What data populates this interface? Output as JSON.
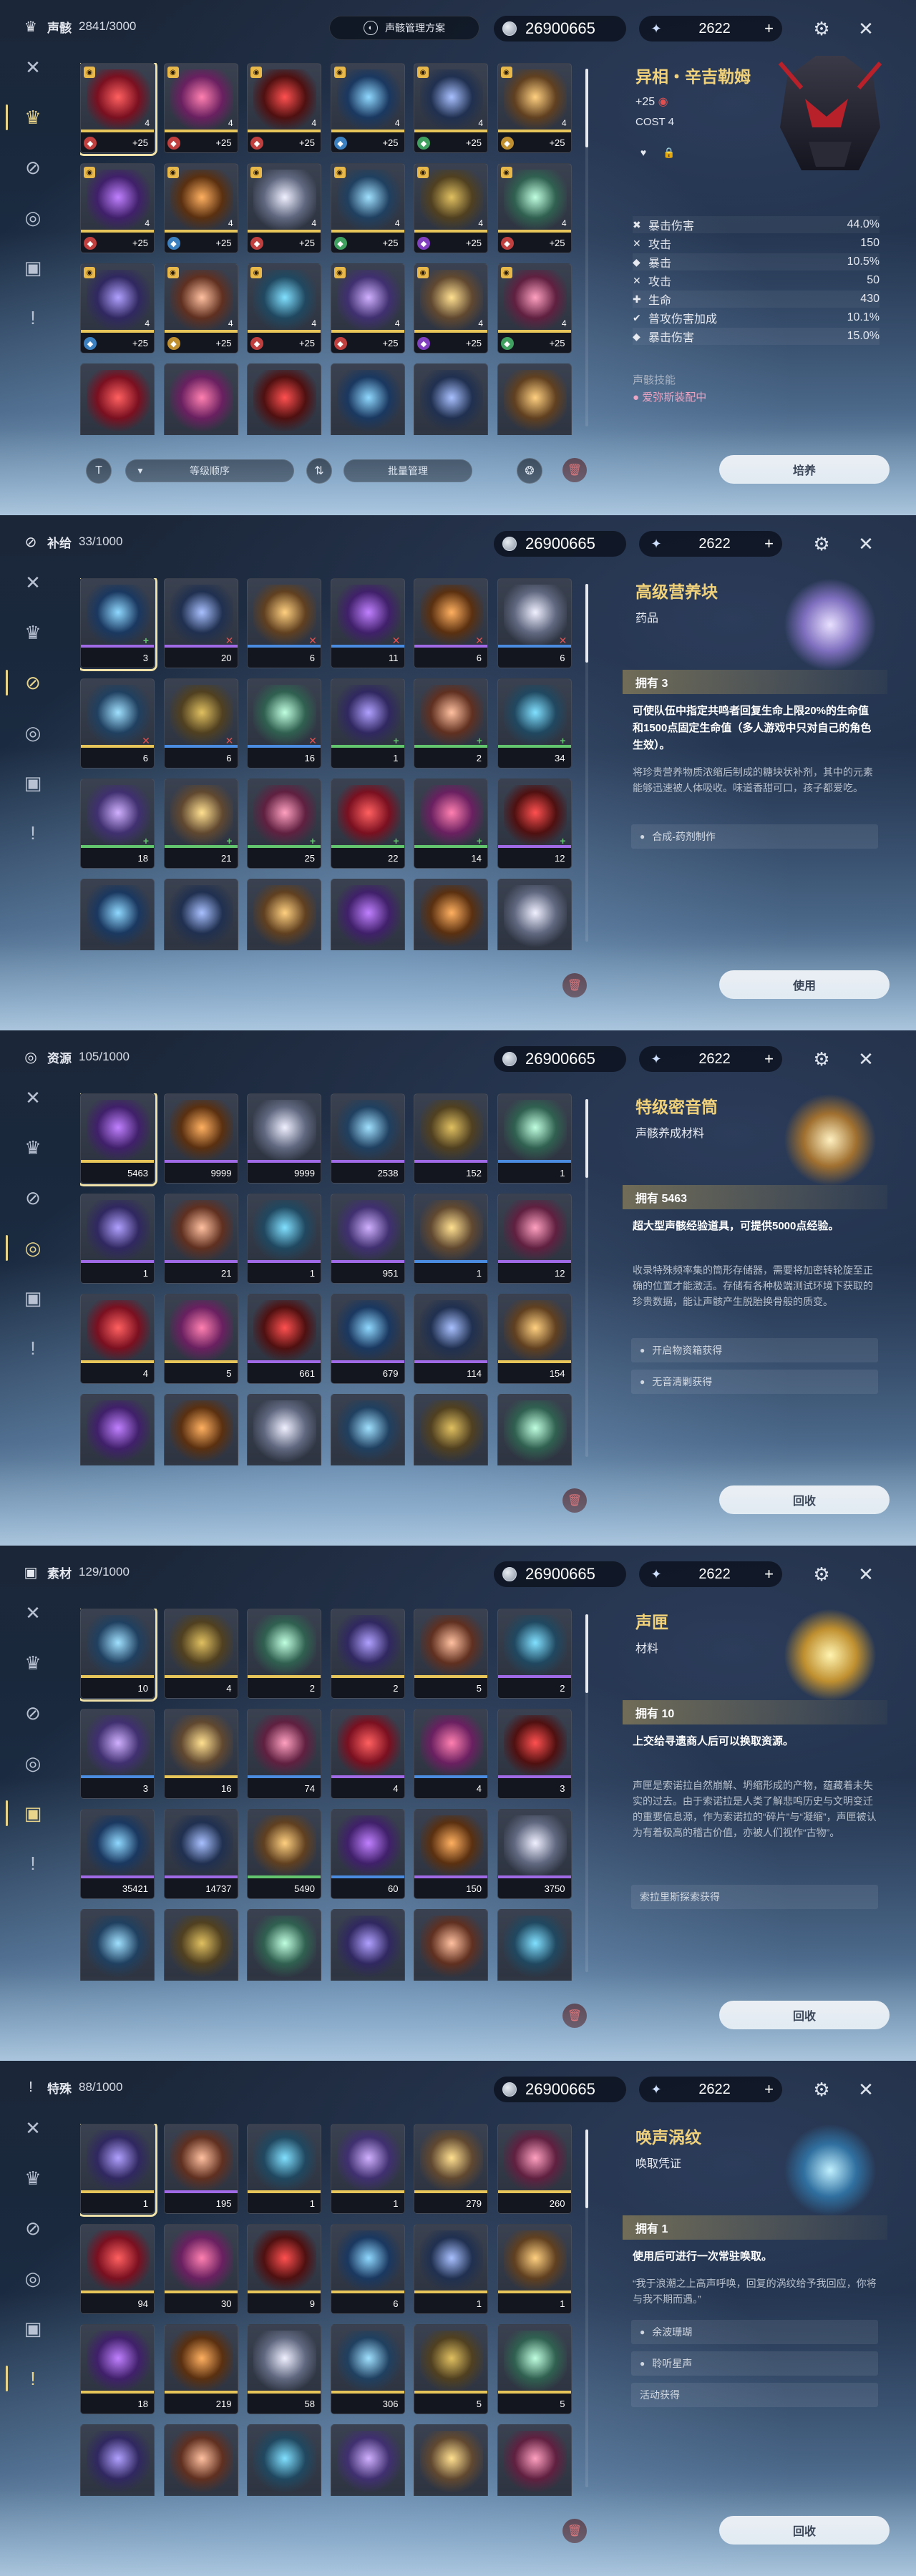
{
  "common": {
    "currency1": "26900665",
    "currency2": "2622",
    "plus": "+",
    "echo_plan_label": "声骸管理方案"
  },
  "panels": [
    {
      "category": "声骸",
      "count": "2841/3000",
      "title": "异相・辛吉勒姆",
      "plus_level": "+25",
      "cost": "COST 4",
      "stats": [
        {
          "name": "暴击伤害",
          "value": "44.0%"
        },
        {
          "name": "攻击",
          "value": "150"
        },
        {
          "name": "暴击",
          "value": "10.5%"
        },
        {
          "name": "攻击",
          "value": "50"
        },
        {
          "name": "生命",
          "value": "430"
        },
        {
          "name": "普攻伤害加成",
          "value": "10.1%"
        },
        {
          "name": "暴击伤害",
          "value": "15.0%"
        }
      ],
      "skill_header": "声骸技能",
      "equipped_by": "爱弥斯装配中",
      "sort_label": "等级顺序",
      "batch_label": "批量管理",
      "action": "培养",
      "grid_labels": [
        "+25",
        "+25",
        "+25",
        "+25",
        "+25",
        "+25",
        "+25",
        "+25",
        "+25",
        "+25",
        "+25",
        "+25",
        "+25",
        "+25",
        "+25",
        "+25",
        "+25",
        "+25",
        "",
        "",
        "",
        "",
        "",
        ""
      ]
    },
    {
      "category": "补给",
      "count": "33/1000",
      "title": "高级营养块",
      "subtitle": "药品",
      "owned": "拥有 3",
      "bold": "可使队伍中指定共鸣者回复生命上限20%的生命值和1500点固定生命值（多人游戏中只对自己的角色生效）。",
      "desc": "将珍贵营养物质浓缩后制成的糖块状补剂，其中的元素能够迅速被人体吸收。味道香甜可口，孩子都爱吃。",
      "sources": [
        "合成-药剂制作"
      ],
      "action": "使用",
      "grid_labels": [
        "3",
        "20",
        "6",
        "11",
        "6",
        "6",
        "6",
        "6",
        "16",
        "1",
        "2",
        "34",
        "18",
        "21",
        "25",
        "22",
        "14",
        "12",
        "",
        "",
        "",
        "",
        "",
        ""
      ]
    },
    {
      "category": "资源",
      "count": "105/1000",
      "title": "特级密音筒",
      "subtitle": "声骸养成材料",
      "owned": "拥有 5463",
      "bold": "超大型声骸经验道具，可提供5000点经验。",
      "desc": "收录特殊频率集的筒形存储器，需要将加密转轮旋至正确的位置才能激活。存储有各种极端测试环境下获取的珍贵数据，能让声骸产生脱胎换骨般的质变。",
      "sources": [
        "开启物资箱获得",
        "无音清剿获得"
      ],
      "action": "回收",
      "grid_labels": [
        "5463",
        "9999",
        "9999",
        "2538",
        "152",
        "1",
        "1",
        "21",
        "1",
        "951",
        "1",
        "12",
        "4",
        "5",
        "661",
        "679",
        "114",
        "154",
        "",
        "",
        "",
        "",
        "",
        ""
      ]
    },
    {
      "category": "素材",
      "count": "129/1000",
      "title": "声匣",
      "subtitle": "材料",
      "owned": "拥有 10",
      "bold": "上交给寻遗商人后可以换取资源。",
      "desc": "声匣是索诺拉自然崩解、坍缩形成的产物，蕴藏着未失实的过去。由于索诺拉是人类了解悲鸣历史与文明变迁的重要信息源，作为索诺拉的“碎片”与“凝缩”，声匣被认为有着极高的稽古价值，亦被人们视作“古物”。",
      "sources": [
        "索拉里斯探索获得"
      ],
      "action": "回收",
      "grid_labels": [
        "10",
        "4",
        "2",
        "2",
        "5",
        "2",
        "3",
        "16",
        "74",
        "4",
        "4",
        "3",
        "35421",
        "14737",
        "5490",
        "60",
        "150",
        "3750",
        "",
        "",
        "",
        "",
        "",
        ""
      ]
    },
    {
      "category": "特殊",
      "count": "88/1000",
      "title": "唤声涡纹",
      "subtitle": "唤取凭证",
      "owned": "拥有 1",
      "bold": "使用后可进行一次常驻唤取。",
      "desc": "“我于浪潮之上高声呼唤，回复的涡纹给予我回应，你将与我不期而遇。”",
      "sources": [
        "余波珊瑚",
        "聆听星声",
        "活动获得"
      ],
      "action": "回收",
      "grid_labels": [
        "1",
        "195",
        "1",
        "1",
        "279",
        "260",
        "94",
        "30",
        "9",
        "6",
        "1",
        "1",
        "18",
        "219",
        "58",
        "306",
        "5",
        "5",
        "",
        "",
        "",
        "",
        "",
        ""
      ]
    }
  ],
  "nav_icons": [
    "swords-icon",
    "echo-mask-icon",
    "supply-icon",
    "resource-icon",
    "material-icon",
    "special-icon"
  ]
}
